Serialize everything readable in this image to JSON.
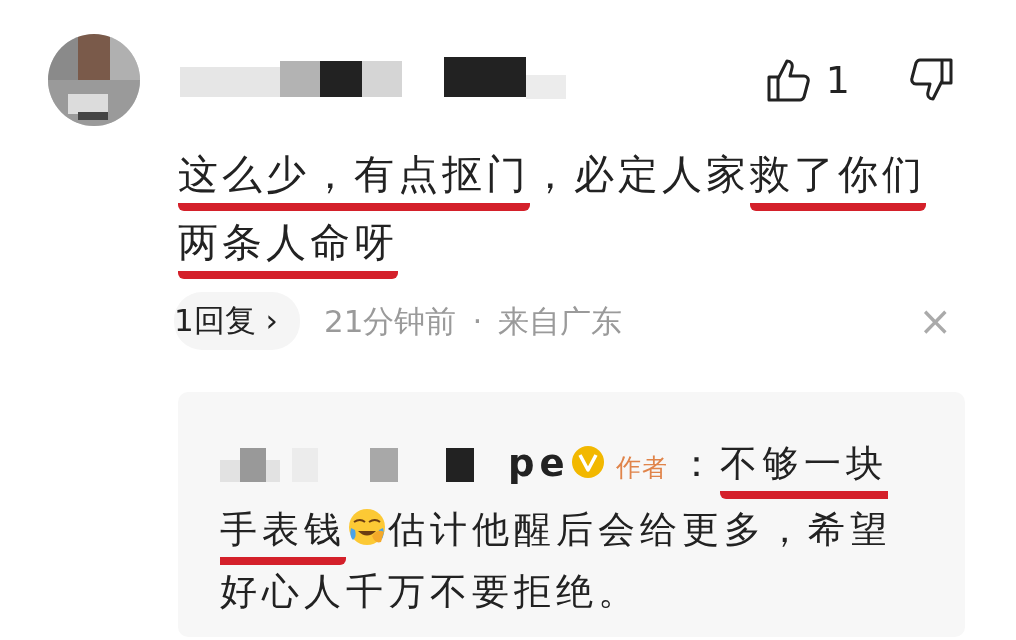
{
  "comment": {
    "like_count": "1",
    "text_parts": [
      {
        "kind": "text",
        "text": "这么少，有点抠门",
        "underlined": true
      },
      {
        "kind": "text",
        "text": "，必定人家",
        "underlined": false
      },
      {
        "kind": "text",
        "text": "救了你们",
        "underlined": true
      },
      {
        "kind": "text",
        "text": "两条人命呀",
        "underlined": true
      }
    ],
    "reply_button": "1回复 ›",
    "time": "21分钟前",
    "separator": "·",
    "location": "来自广东",
    "close": "×"
  },
  "reply": {
    "name_visible": "pe",
    "verified": true,
    "author_tag": "作者",
    "text_parts": [
      {
        "kind": "text",
        "text": "：",
        "underlined": false
      },
      {
        "kind": "text",
        "text": "不够一块手表钱",
        "underlined": true
      },
      {
        "kind": "emoji"
      },
      {
        "kind": "text",
        "text": "估计他醒后会给更多，希望好心人千万不要拒绝。",
        "underlined": false
      }
    ]
  }
}
